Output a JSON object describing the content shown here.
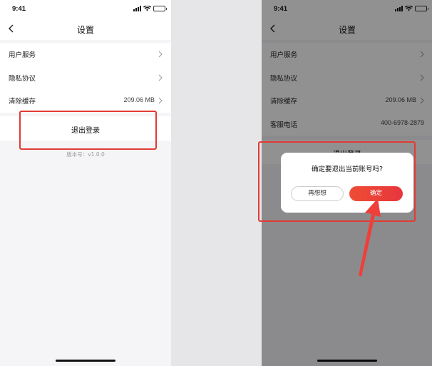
{
  "status_bar": {
    "time": "9:41"
  },
  "left": {
    "nav": {
      "title": "设置"
    },
    "list": [
      {
        "label": "用户服务",
        "value": ""
      },
      {
        "label": "隐私协议",
        "value": ""
      },
      {
        "label": "清除缓存",
        "value": "209.06 MB"
      }
    ],
    "logout": "退出登录",
    "version": "版本号：v1.0.0"
  },
  "right": {
    "nav": {
      "title": "设置"
    },
    "list": [
      {
        "label": "用户服务",
        "value": ""
      },
      {
        "label": "隐私协议",
        "value": ""
      },
      {
        "label": "清除缓存",
        "value": "209.06 MB"
      },
      {
        "label": "客服电话",
        "value": "400-6978-2879"
      }
    ],
    "logout": "退出登录",
    "dialog": {
      "message": "确定要退出当前账号吗?",
      "cancel": "再想想",
      "confirm": "确定"
    }
  },
  "colors": {
    "accent": "#e7363e",
    "annotation": "#e23b35"
  }
}
